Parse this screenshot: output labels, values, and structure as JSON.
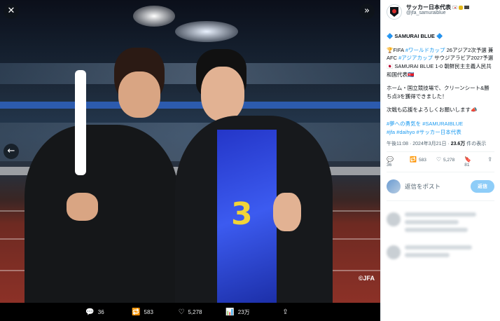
{
  "viewer": {
    "close_icon": "close-icon",
    "expand_icon": "chevrons-right-icon",
    "prev_icon": "arrow-left-icon",
    "copyright": "©JFA",
    "actions": [
      {
        "icon": "💬",
        "name": "reply",
        "count": "36"
      },
      {
        "icon": "🔁",
        "name": "retweet",
        "count": "583"
      },
      {
        "icon": "♡",
        "name": "like",
        "count": "5,278"
      },
      {
        "icon": "📊",
        "name": "views",
        "count": "23万"
      },
      {
        "icon": "⇪",
        "name": "share",
        "count": ""
      }
    ]
  },
  "post": {
    "display_name": "サッカー日本代表",
    "handle": "@jfa_samuraiblue",
    "lines": {
      "title": "🔷 SAMURAI BLUE 🔷",
      "p1_a": "🏆FIFA ",
      "p1_tag1": "#ワールドカップ",
      "p1_b": " 26アジア2次予選 兼 AFC ",
      "p1_tag2": "#アジアカップ",
      "p1_c": " サウジアラビア2027予選",
      "p1_d": "🇯🇵 SAMURAI BLUE 1-0 朝鮮民主主義人民共和国代表🇰🇵",
      "p2": "ホーム・国立競技場で、クリーンシート&勝ち点3を獲得できました！",
      "p3": "次戦も応援をよろしくお願いします📣",
      "tags_a": "#夢への勇気を #SAMURAIBLUE",
      "tags_b": "#jfa #daihyo #サッカー日本代表"
    },
    "meta_time": "午後11:08 · 2024年3月21日 · ",
    "meta_views": "23.6万",
    "meta_suffix": " 件の表示",
    "stats": [
      {
        "icon": "💬",
        "count": "36"
      },
      {
        "icon": "🔁",
        "count": "583"
      },
      {
        "icon": "♡",
        "count": "5,278"
      },
      {
        "icon": "🔖",
        "count": "81"
      },
      {
        "icon": "⇪",
        "count": ""
      }
    ],
    "reply_placeholder": "返信をポスト",
    "reply_button": "返信"
  },
  "colors": {
    "accent": "#1d9bf0",
    "reply_button": "#8ecdf8"
  }
}
